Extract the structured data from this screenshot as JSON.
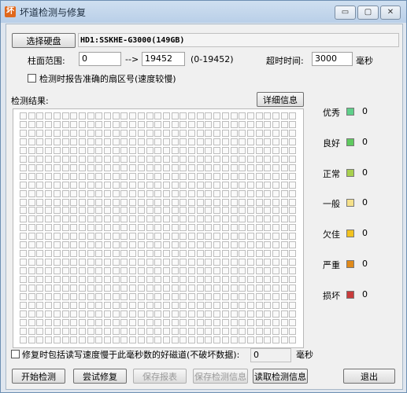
{
  "window": {
    "title": "坏道检测与修复",
    "app_icon": "坏",
    "minimize_glyph": "▭",
    "maximize_glyph": "▢",
    "close_glyph": "✕"
  },
  "disk": {
    "select_label": "选择硬盘",
    "info": "HD1:SSKHE-G3000(149GB)"
  },
  "range": {
    "label": "柱面范围:",
    "start": "0",
    "arrow": "-->",
    "end": "19452",
    "hint": "(0-19452)"
  },
  "timeout": {
    "label": "超时时间:",
    "value": "3000",
    "unit": "毫秒"
  },
  "report_option": {
    "label": "检测时报告准确的扇区号(速度较慢)"
  },
  "results": {
    "label": "检测结果:",
    "detail_button": "详细信息"
  },
  "grid": {
    "rows": 27,
    "cols": 33
  },
  "legend": [
    {
      "label": "优秀",
      "color": "#5fd08a",
      "count": "0"
    },
    {
      "label": "良好",
      "color": "#5fca5f",
      "count": "0"
    },
    {
      "label": "正常",
      "color": "#a8d04e",
      "count": "0"
    },
    {
      "label": "一般",
      "color": "#f5e08a",
      "count": "0"
    },
    {
      "label": "欠佳",
      "color": "#f2c21f",
      "count": "0"
    },
    {
      "label": "严重",
      "color": "#e08a1a",
      "count": "0"
    },
    {
      "label": "损坏",
      "color": "#c83b3b",
      "count": "0"
    }
  ],
  "repair_option": {
    "label": "修复时包括读写速度慢于此毫秒数的好磁道(不破坏数据):",
    "value": "0",
    "unit": "毫秒"
  },
  "buttons": {
    "start": "开始检测",
    "try_repair": "尝试修复",
    "save_report": "保存报表",
    "save_info": "保存检测信息",
    "read_info": "读取检测信息",
    "exit": "退出"
  }
}
